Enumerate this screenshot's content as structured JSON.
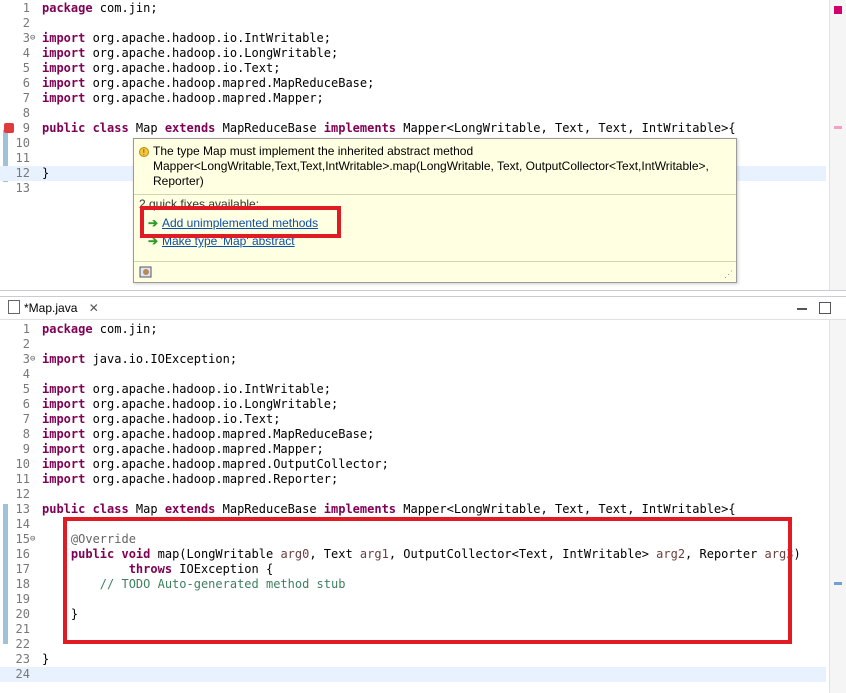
{
  "top_editor": {
    "lines": [
      {
        "n": "1",
        "html": "<span class='kw'>package</span> com.jin;"
      },
      {
        "n": "2",
        "html": ""
      },
      {
        "n": "3",
        "html": "<span class='kw'>import</span> org.apache.hadoop.io.IntWritable;"
      },
      {
        "n": "4",
        "html": "<span class='kw'>import</span> org.apache.hadoop.io.LongWritable;"
      },
      {
        "n": "5",
        "html": "<span class='kw'>import</span> org.apache.hadoop.io.Text;"
      },
      {
        "n": "6",
        "html": "<span class='kw'>import</span> org.apache.hadoop.mapred.MapReduceBase;"
      },
      {
        "n": "7",
        "html": "<span class='kw'>import</span> org.apache.hadoop.mapred.Mapper;"
      },
      {
        "n": "8",
        "html": ""
      },
      {
        "n": "9",
        "html": "<span class='kw'>public class</span> Map <span class='kw'>extends</span> MapReduceBase <span class='kw'>implements</span> Mapper&lt;LongWritable, Text, Text, IntWritable&gt;{"
      },
      {
        "n": "10",
        "html": ""
      },
      {
        "n": "11",
        "html": ""
      },
      {
        "n": "12",
        "html": "}"
      },
      {
        "n": "13",
        "html": ""
      }
    ]
  },
  "hover": {
    "message": "The type Map must implement the inherited abstract method Mapper<LongWritable,Text,Text,IntWritable>.map(LongWritable, Text, OutputCollector<Text,IntWritable>, Reporter)",
    "quick_fixes_title": "2 quick fixes available:",
    "fixes": [
      "Add unimplemented methods",
      "Make type 'Map' abstract"
    ]
  },
  "bottom_editor": {
    "tab_label": "*Map.java",
    "lines": [
      {
        "n": "1",
        "html": "<span class='kw'>package</span> com.jin;"
      },
      {
        "n": "2",
        "html": ""
      },
      {
        "n": "3",
        "html": "<span class='kw'>import</span> java.io.IOException;"
      },
      {
        "n": "4",
        "html": ""
      },
      {
        "n": "5",
        "html": "<span class='kw'>import</span> org.apache.hadoop.io.IntWritable;"
      },
      {
        "n": "6",
        "html": "<span class='kw'>import</span> org.apache.hadoop.io.LongWritable;"
      },
      {
        "n": "7",
        "html": "<span class='kw'>import</span> org.apache.hadoop.io.Text;"
      },
      {
        "n": "8",
        "html": "<span class='kw'>import</span> org.apache.hadoop.mapred.MapReduceBase;"
      },
      {
        "n": "9",
        "html": "<span class='kw'>import</span> org.apache.hadoop.mapred.Mapper;"
      },
      {
        "n": "10",
        "html": "<span class='kw'>import</span> org.apache.hadoop.mapred.OutputCollector;"
      },
      {
        "n": "11",
        "html": "<span class='kw'>import</span> org.apache.hadoop.mapred.Reporter;"
      },
      {
        "n": "12",
        "html": ""
      },
      {
        "n": "13",
        "html": "<span class='kw'>public class</span> Map <span class='kw'>extends</span> MapReduceBase <span class='kw'>implements</span> Mapper&lt;LongWritable, Text, Text, IntWritable&gt;{"
      },
      {
        "n": "14",
        "html": ""
      },
      {
        "n": "15",
        "html": "    <span class='ann'>@Override</span>"
      },
      {
        "n": "16",
        "html": "    <span class='kw'>public void</span> map(LongWritable <span class='var'>arg0</span>, Text <span class='var'>arg1</span>, OutputCollector&lt;Text, IntWritable&gt; <span class='var'>arg2</span>, Reporter <span class='var'>arg3</span>)"
      },
      {
        "n": "17",
        "html": "            <span class='kw'>throws</span> IOException {"
      },
      {
        "n": "18",
        "html": "        <span class='cmt'>// TODO Auto-generated method stub</span>"
      },
      {
        "n": "19",
        "html": ""
      },
      {
        "n": "20",
        "html": "    }"
      },
      {
        "n": "21",
        "html": ""
      },
      {
        "n": "22",
        "html": ""
      },
      {
        "n": "23",
        "html": "}"
      },
      {
        "n": "24",
        "html": ""
      }
    ]
  },
  "colors": {
    "keyword": "#7f0055",
    "comment": "#3f7f5f",
    "annotation": "#646464",
    "highlight": "#e8f2fe",
    "callout": "#e01b24"
  }
}
